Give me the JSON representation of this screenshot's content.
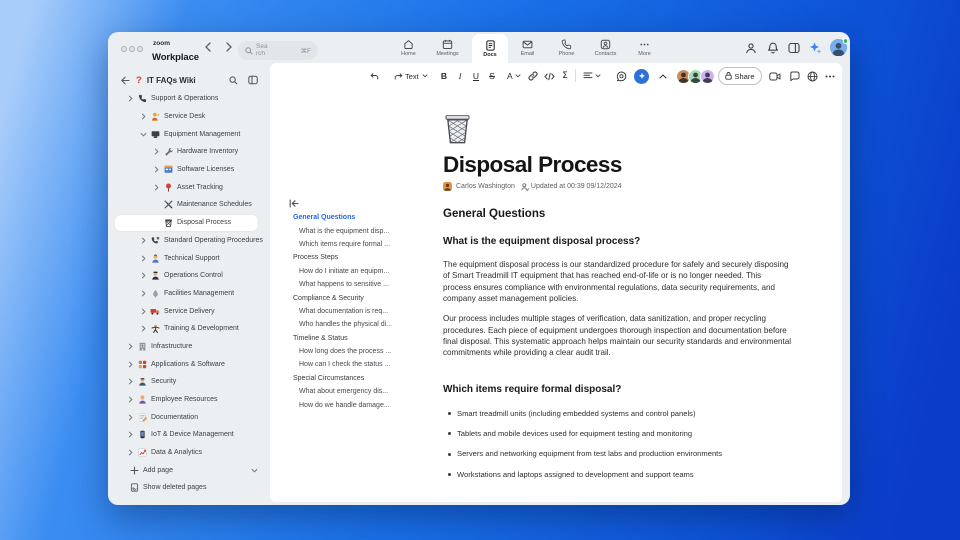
{
  "titlebar": {
    "logo_top": "zoom",
    "logo_bottom": "Workplace",
    "search": {
      "placeholder": "Search",
      "shortcut": "⌘F"
    },
    "tabs": [
      {
        "label": "Home",
        "icon": "home-icon",
        "active": false
      },
      {
        "label": "Meetings",
        "icon": "meetings-icon",
        "active": false
      },
      {
        "label": "Docs",
        "icon": "docs-icon",
        "active": true
      },
      {
        "label": "Email",
        "icon": "email-icon",
        "active": false
      },
      {
        "label": "Phone",
        "icon": "phone-tab-icon",
        "active": false
      },
      {
        "label": "Contacts",
        "icon": "contacts-icon",
        "active": false
      },
      {
        "label": "More",
        "icon": "more-icon",
        "active": false
      }
    ]
  },
  "sidebar": {
    "wiki_title": "IT FAQs Wiki",
    "items": [
      {
        "label": "Support & Operations",
        "icon": "phone-icon",
        "level": 0,
        "chevron": "right"
      },
      {
        "label": "Service Desk",
        "icon": "service-desk-icon",
        "level": 1,
        "chevron": "right"
      },
      {
        "label": "Equipment Management",
        "icon": "monitor-icon",
        "level": 1,
        "chevron": "down"
      },
      {
        "label": "Hardware Inventory",
        "icon": "wrench-icon",
        "level": 2,
        "chevron": "right"
      },
      {
        "label": "Software Licenses",
        "icon": "software-icon",
        "level": 2,
        "chevron": "right"
      },
      {
        "label": "Asset Tracking",
        "icon": "pin-icon",
        "level": 2,
        "chevron": "right"
      },
      {
        "label": "Maintenance Schedules",
        "icon": "tools-icon",
        "level": 2,
        "chevron": "none"
      },
      {
        "label": "Disposal Process",
        "icon": "wastebasket-icon",
        "level": 2,
        "chevron": "none",
        "selected": true
      },
      {
        "label": "Standard Operating Procedures",
        "icon": "procedures-icon",
        "level": 1,
        "chevron": "right"
      },
      {
        "label": "Technical Support",
        "icon": "technician-icon",
        "level": 1,
        "chevron": "right"
      },
      {
        "label": "Operations Control",
        "icon": "operator-icon",
        "level": 1,
        "chevron": "right"
      },
      {
        "label": "Facilities Management",
        "icon": "facilities-icon",
        "level": 1,
        "chevron": "right"
      },
      {
        "label": "Service Delivery",
        "icon": "truck-icon",
        "level": 1,
        "chevron": "right"
      },
      {
        "label": "Training & Development",
        "icon": "training-icon",
        "level": 1,
        "chevron": "right"
      },
      {
        "label": "Infrastructure",
        "icon": "building-icon",
        "level": 0,
        "chevron": "right"
      },
      {
        "label": "Applications & Software",
        "icon": "apps-icon",
        "level": 0,
        "chevron": "right"
      },
      {
        "label": "Security",
        "icon": "guard-icon",
        "level": 0,
        "chevron": "right"
      },
      {
        "label": "Employee Resources",
        "icon": "employee-icon",
        "level": 0,
        "chevron": "right"
      },
      {
        "label": "Documentation",
        "icon": "memo-icon",
        "level": 0,
        "chevron": "right"
      },
      {
        "label": "IoT & Device Management",
        "icon": "device-icon",
        "level": 0,
        "chevron": "right"
      },
      {
        "label": "Data & Analytics",
        "icon": "chart-icon",
        "level": 0,
        "chevron": "right"
      }
    ],
    "add_page": "Add page",
    "show_deleted": "Show deleted pages"
  },
  "toolbar": {
    "text_style": "Text",
    "share_label": "Share"
  },
  "toc": {
    "items": [
      {
        "label": "General Questions",
        "type": "section",
        "active": true
      },
      {
        "label": "What is the equipment disp...",
        "type": "item"
      },
      {
        "label": "Which items require formal ...",
        "type": "item"
      },
      {
        "label": "Process Steps",
        "type": "section"
      },
      {
        "label": "How do I initiate an equipm...",
        "type": "item"
      },
      {
        "label": "What happens to sensitive ...",
        "type": "item"
      },
      {
        "label": "Compliance & Security",
        "type": "section"
      },
      {
        "label": "What documentation is req...",
        "type": "item"
      },
      {
        "label": "Who handles the physical di...",
        "type": "item"
      },
      {
        "label": "Timeline & Status",
        "type": "section"
      },
      {
        "label": "How long does the process ...",
        "type": "item"
      },
      {
        "label": "How can I check the status ...",
        "type": "item"
      },
      {
        "label": "Special Circumstances",
        "type": "section"
      },
      {
        "label": "What about emergency dis...",
        "type": "item"
      },
      {
        "label": "How do we handle damage...",
        "type": "item"
      }
    ]
  },
  "document": {
    "title": "Disposal Process",
    "author": "Carlos Washington",
    "updated": "Updated at 00:39 09/12/2024",
    "h2": "General Questions",
    "h3_first": "What is the equipment disposal process?",
    "paragraphs": [
      [
        "The equipment disposal process is our standardized procedure for safely and securely disposing",
        "of Smart Treadmill IT equipment that has reached end-of-life or is no longer needed. This",
        "process ensures compliance with environmental regulations, data security requirements, and",
        "company asset management policies."
      ],
      [
        "Our process includes multiple stages of verification, data sanitization, and proper recycling",
        "procedures. Each piece of equipment undergoes thorough inspection and documentation before",
        "final disposal. This systematic approach helps maintain our security standards and environmental",
        "commitments while providing a clear audit trail."
      ]
    ],
    "h3_second": "Which items require formal disposal?",
    "bullets": [
      "Smart treadmill units (including embedded systems and control panels)",
      "Tablets and mobile devices used for equipment testing and monitoring",
      "Servers and networking equipment from test labs and production environments",
      "Workstations and laptops assigned to development and support teams"
    ]
  }
}
